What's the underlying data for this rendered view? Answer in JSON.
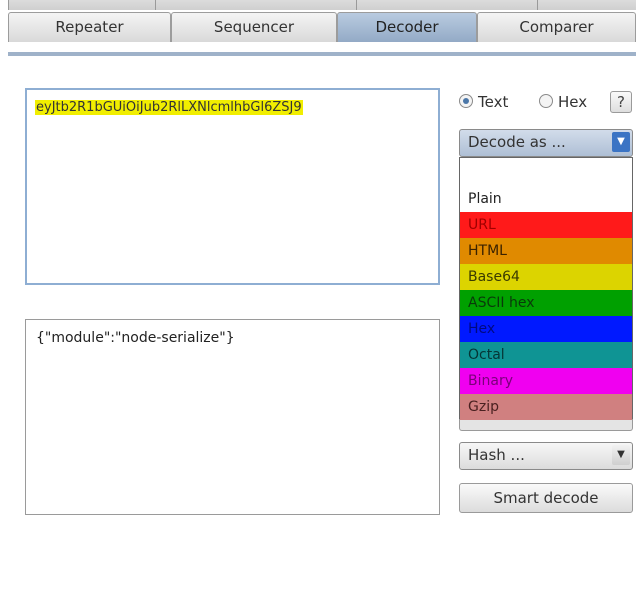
{
  "tabs": [
    {
      "label": "Repeater",
      "active": false
    },
    {
      "label": "Sequencer",
      "active": false
    },
    {
      "label": "Decoder",
      "active": true
    },
    {
      "label": "Comparer",
      "active": false
    }
  ],
  "input": {
    "encoded_text": "eyJtb2R1bGUiOiJub2RlLXNlcmlhbGl6ZSJ9"
  },
  "output": {
    "decoded_text": "{\"module\":\"node-serialize\"}"
  },
  "mode": {
    "text_label": "Text",
    "hex_label": "Hex",
    "selected": "Text",
    "help_label": "?"
  },
  "decode_dropdown": {
    "label": "Decode as ...",
    "options": [
      {
        "label": "",
        "color": "#ffffff"
      },
      {
        "label": "Plain",
        "color": "#ffffff"
      },
      {
        "label": "URL",
        "color": "#ff1a1a"
      },
      {
        "label": "HTML",
        "color": "#e08a00"
      },
      {
        "label": "Base64",
        "color": "#dcd400"
      },
      {
        "label": "ASCII hex",
        "color": "#00a000"
      },
      {
        "label": "Hex",
        "color": "#0019ff"
      },
      {
        "label": "Octal",
        "color": "#0f9494"
      },
      {
        "label": "Binary",
        "color": "#f000f0"
      },
      {
        "label": "Gzip",
        "color": "#d08080"
      }
    ]
  },
  "hash_dropdown": {
    "label": "Hash ..."
  },
  "smart_decode": {
    "label": "Smart decode"
  }
}
